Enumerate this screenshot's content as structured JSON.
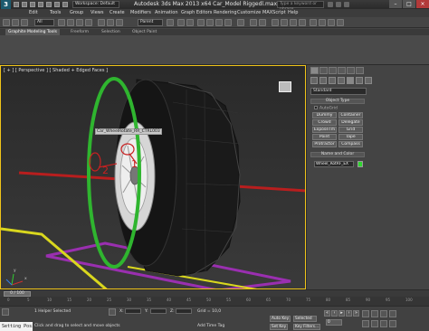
{
  "window": {
    "app_logo": "3",
    "workspace": "Workspace: Default",
    "title": "Autodesk 3ds Max  2013 x64      Car_Model Riggedl.max",
    "search_placeholder": "Type a keyword or phrase"
  },
  "menu": [
    "Edit",
    "Tools",
    "Group",
    "Views",
    "Create",
    "Modifiers",
    "Animation",
    "Graph Editors",
    "Rendering",
    "Customize",
    "MAXScript",
    "Help"
  ],
  "toolbar": {
    "filter_value": "All",
    "coord_system": "Parent"
  },
  "ribbon": {
    "tabs": [
      "Graphite Modeling Tools",
      "Freeform",
      "Selection",
      "Object Paint"
    ]
  },
  "viewport": {
    "label": "[ + ] [ Perspective ] [ Shaded + Edged Faces ]",
    "selected_label": "Car_WheelRotate_RR_CTRL003",
    "annotations": [
      "1",
      "2"
    ],
    "axis_labels": [
      "x",
      "y"
    ]
  },
  "command_panel": {
    "category": "Standard",
    "object_type_title": "Object Type",
    "autogrid": "AutoGrid",
    "buttons": [
      "Dummy",
      "Container",
      "Crowd",
      "Delegate",
      "ExposeTm",
      "Grid",
      "Point",
      "Tape",
      "Protractor",
      "Compass"
    ],
    "name_color_title": "Name and Color",
    "object_name": "Wheel_RotRF_EX",
    "object_color": "#2fd62f"
  },
  "timeline": {
    "frame_display": "0 / 100",
    "ticks": [
      "0",
      "5",
      "10",
      "15",
      "20",
      "25",
      "30",
      "35",
      "40",
      "45",
      "50",
      "55",
      "60",
      "65",
      "70",
      "75",
      "80",
      "85",
      "90",
      "95",
      "100"
    ]
  },
  "status": {
    "listener": "Setting Posi",
    "selection": "1 Helper Selected",
    "prompt": "Click and drag to select and move objects",
    "grid": "Grid = 10,0",
    "add_time_tag": "Add Time Tag",
    "auto_key": "Auto Key",
    "selected_mode": "Selected",
    "set_key": "Set Key",
    "key_filters": "Key Filters...",
    "frame": "0"
  }
}
